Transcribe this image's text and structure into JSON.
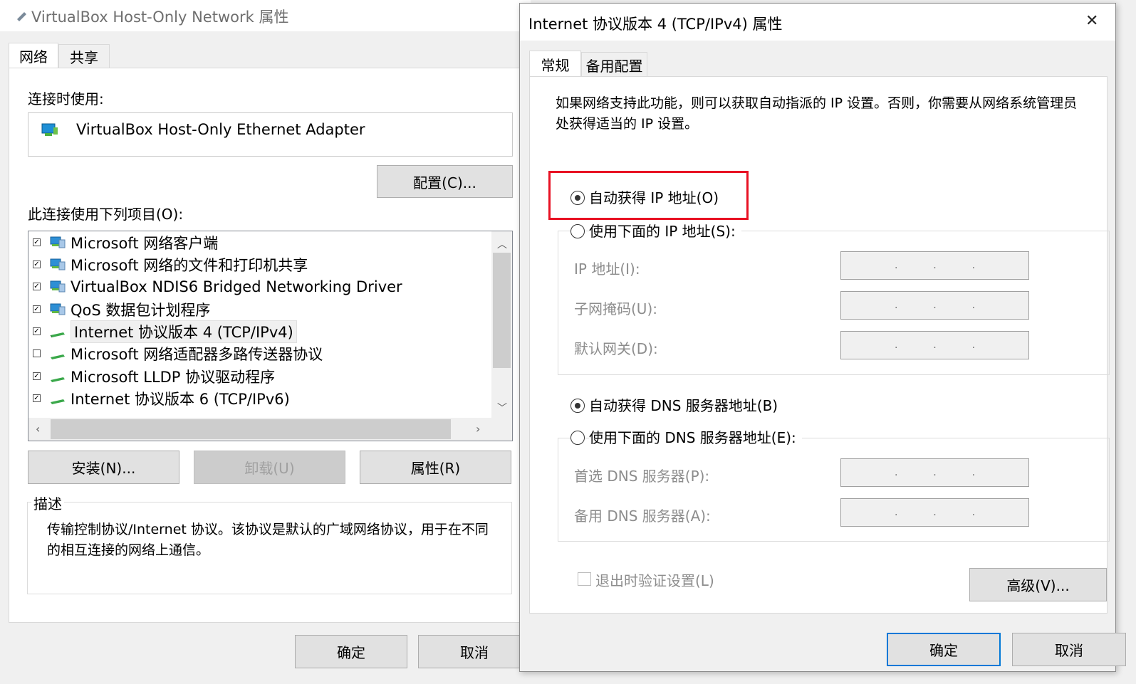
{
  "left_dialog": {
    "title": "VirtualBox Host-Only Network 属性",
    "tabs": [
      "网络",
      "共享"
    ],
    "connect_using_label": "连接时使用:",
    "adapter_name": "VirtualBox Host-Only Ethernet Adapter",
    "configure_button": "配置(C)...",
    "items_label": "此连接使用下列项目(O):",
    "items": [
      {
        "label": "Microsoft 网络客户端",
        "checked": true
      },
      {
        "label": "Microsoft 网络的文件和打印机共享",
        "checked": true
      },
      {
        "label": "VirtualBox NDIS6 Bridged Networking Driver",
        "checked": true
      },
      {
        "label": "QoS 数据包计划程序",
        "checked": true
      },
      {
        "label": "Internet 协议版本 4 (TCP/IPv4)",
        "checked": true
      },
      {
        "label": "Microsoft 网络适配器多路传送器协议",
        "checked": false
      },
      {
        "label": "Microsoft LLDP 协议驱动程序",
        "checked": true
      },
      {
        "label": "Internet 协议版本 6 (TCP/IPv6)",
        "checked": true
      }
    ],
    "install_button": "安装(N)...",
    "uninstall_button": "卸载(U)",
    "properties_button": "属性(R)",
    "description_label": "描述",
    "description_text": "传输控制协议/Internet 协议。该协议是默认的广域网络协议，用于在不同的相互连接的网络上通信。",
    "ok_button": "确定",
    "cancel_button": "取消"
  },
  "right_dialog": {
    "title": "Internet 协议版本 4 (TCP/IPv4) 属性",
    "close_glyph": "✕",
    "tabs": [
      "常规",
      "备用配置"
    ],
    "intro_text": "如果网络支持此功能，则可以获取自动指派的 IP 设置。否则，你需要从网络系统管理员处获得适当的 IP 设置。",
    "auto_ip_label": "自动获得 IP 地址(O)",
    "manual_ip_label": "使用下面的 IP 地址(S):",
    "ip_address_label": "IP 地址(I):",
    "subnet_label": "子网掩码(U):",
    "gateway_label": "默认网关(D):",
    "auto_dns_label": "自动获得 DNS 服务器地址(B)",
    "manual_dns_label": "使用下面的 DNS 服务器地址(E):",
    "preferred_dns_label": "首选 DNS 服务器(P):",
    "alternate_dns_label": "备用 DNS 服务器(A):",
    "validate_label": "退出时验证设置(L)",
    "advanced_button": "高级(V)...",
    "ok_button": "确定",
    "cancel_button": "取消",
    "ip_dot": "."
  },
  "colors": {
    "highlight_box": "#e81123",
    "default_button_border": "#0078d7"
  }
}
